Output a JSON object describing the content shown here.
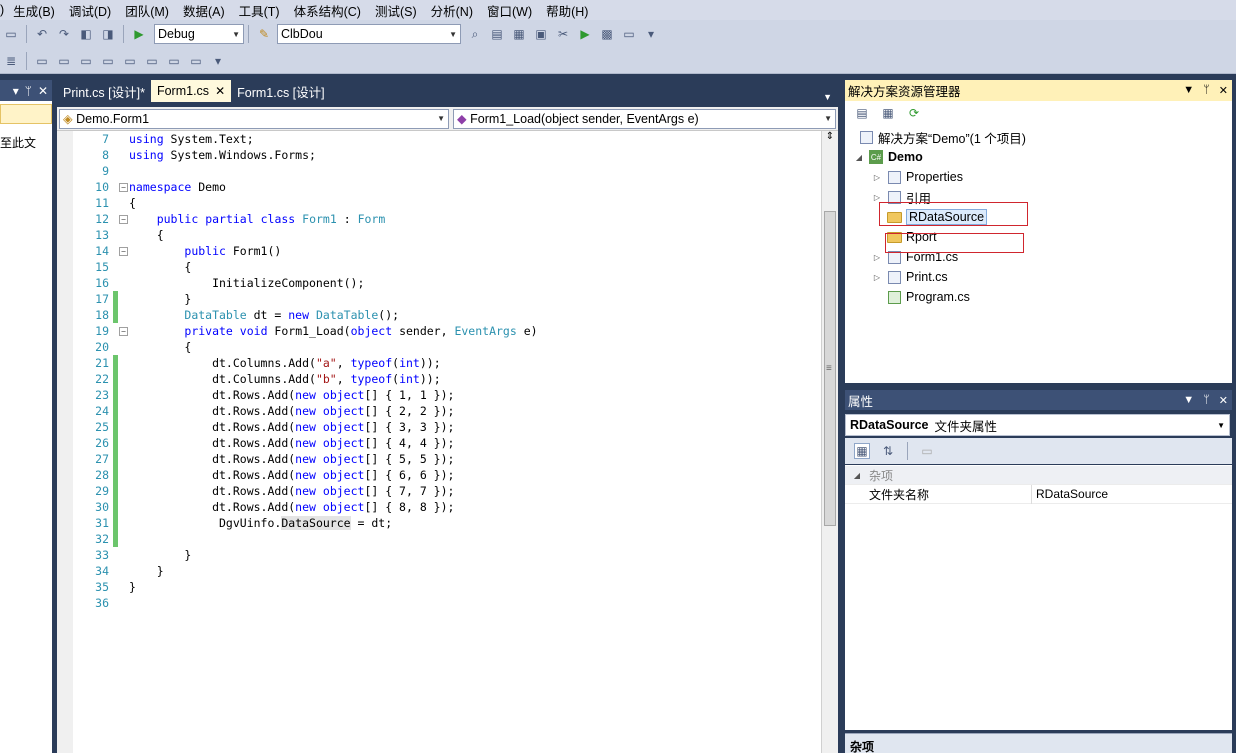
{
  "menu": [
    "生成(B)",
    "调试(D)",
    "团队(M)",
    "数据(A)",
    "工具(T)",
    "体系结构(C)",
    "测试(S)",
    "分析(N)",
    "窗口(W)",
    "帮助(H)"
  ],
  "menu_prefix": ")",
  "toolbar": {
    "config_combo": "Debug",
    "platform_combo": "ClbDou"
  },
  "left_panel": {
    "text": "至此文"
  },
  "editor": {
    "tabs": [
      {
        "label": "Print.cs [设计]*",
        "active": false
      },
      {
        "label": "Form1.cs",
        "active": true
      },
      {
        "label": "Form1.cs [设计]",
        "active": false
      }
    ],
    "type_combo": "Demo.Form1",
    "member_combo": "Form1_Load(object sender, EventArgs e)",
    "lines": [
      {
        "n": "7",
        "text": "using System.Text;",
        "chg": false
      },
      {
        "n": "8",
        "text": "using System.Windows.Forms;",
        "chg": false
      },
      {
        "n": "9",
        "text": "",
        "chg": false
      },
      {
        "n": "10",
        "text": "namespace Demo",
        "chg": false
      },
      {
        "n": "11",
        "text": "{",
        "chg": false
      },
      {
        "n": "12",
        "text": "    public partial class Form1 : Form",
        "chg": false
      },
      {
        "n": "13",
        "text": "    {",
        "chg": false
      },
      {
        "n": "14",
        "text": "        public Form1()",
        "chg": false
      },
      {
        "n": "15",
        "text": "        {",
        "chg": false
      },
      {
        "n": "16",
        "text": "            InitializeComponent();",
        "chg": false
      },
      {
        "n": "17",
        "text": "        }",
        "chg": true
      },
      {
        "n": "18",
        "text": "        DataTable dt = new DataTable();",
        "chg": true
      },
      {
        "n": "19",
        "text": "        private void Form1_Load(object sender, EventArgs e)",
        "chg": false
      },
      {
        "n": "20",
        "text": "        {",
        "chg": false
      },
      {
        "n": "21",
        "text": "            dt.Columns.Add(\"a\", typeof(int));",
        "chg": true
      },
      {
        "n": "22",
        "text": "            dt.Columns.Add(\"b\", typeof(int));",
        "chg": true
      },
      {
        "n": "23",
        "text": "            dt.Rows.Add(new object[] { 1, 1 });",
        "chg": true
      },
      {
        "n": "24",
        "text": "            dt.Rows.Add(new object[] { 2, 2 });",
        "chg": true
      },
      {
        "n": "25",
        "text": "            dt.Rows.Add(new object[] { 3, 3 });",
        "chg": true
      },
      {
        "n": "26",
        "text": "            dt.Rows.Add(new object[] { 4, 4 });",
        "chg": true
      },
      {
        "n": "27",
        "text": "            dt.Rows.Add(new object[] { 5, 5 });",
        "chg": true
      },
      {
        "n": "28",
        "text": "            dt.Rows.Add(new object[] { 6, 6 });",
        "chg": true
      },
      {
        "n": "29",
        "text": "            dt.Rows.Add(new object[] { 7, 7 });",
        "chg": true
      },
      {
        "n": "30",
        "text": "            dt.Rows.Add(new object[] { 8, 8 });",
        "chg": true
      },
      {
        "n": "31",
        "text": "             DgvUinfo.DataSource = dt;",
        "chg": true
      },
      {
        "n": "32",
        "text": "",
        "chg": true
      },
      {
        "n": "33",
        "text": "        }",
        "chg": false
      },
      {
        "n": "34",
        "text": "    }",
        "chg": false
      },
      {
        "n": "35",
        "text": "}",
        "chg": false
      },
      {
        "n": "36",
        "text": "",
        "chg": false
      }
    ]
  },
  "solution_explorer": {
    "title": "解决方案资源管理器",
    "root": "解决方案“Demo”(1 个项目)",
    "project": "Demo",
    "items": [
      "Properties",
      "引用",
      "RDataSource",
      "Rport",
      "Form1.cs",
      "Print.cs",
      "Program.cs"
    ]
  },
  "properties": {
    "title": "属性",
    "object": "RDataSource",
    "object_type": "文件夹属性",
    "category": "杂项",
    "rows": [
      {
        "name": "文件夹名称",
        "value": "RDataSource"
      }
    ],
    "description_title": "杂项"
  }
}
